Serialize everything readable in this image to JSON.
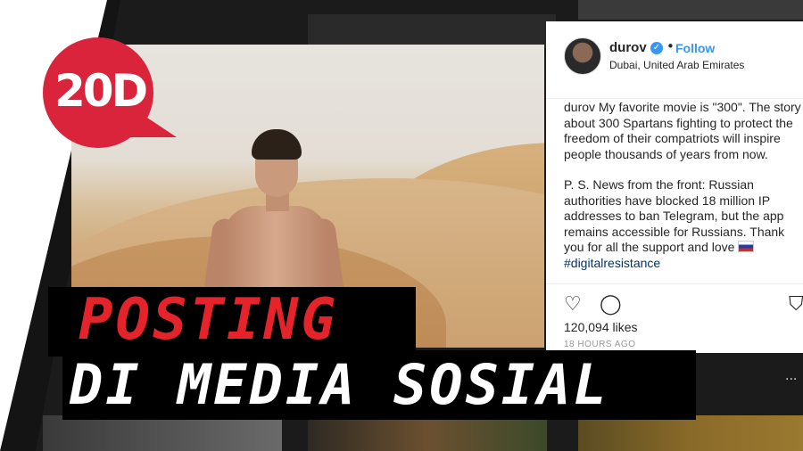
{
  "logo": {
    "text": "20D"
  },
  "post": {
    "username": "durov",
    "follow_label": "Follow",
    "location": "Dubai, United Arab Emirates",
    "caption_p1": "durov My favorite movie is \"300\". The story about 300 Spartans fighting to protect the freedom of their compatriots will inspire people thousands of years from now.",
    "caption_p2": "P. S. News from the front: Russian authorities have blocked 18 million IP addresses to ban Telegram, but the app remains accessible for Russians. Thank you for all the support and love",
    "hashtag": "#digitalresistance",
    "likes": "120,094 likes",
    "time": "18 HOURS AGO",
    "icons": [
      "heart-icon",
      "comment-icon",
      "bookmark-icon",
      "verified-badge-icon",
      "more-options-icon"
    ],
    "colors": {
      "link": "#3897f0",
      "hashtag": "#003569"
    }
  },
  "overlay": {
    "line1": "POSTING",
    "line2": "DI MEDIA SOSIAL",
    "colors": {
      "line1": "#e5232b",
      "line2": "#ffffff",
      "box": "#000000"
    }
  }
}
